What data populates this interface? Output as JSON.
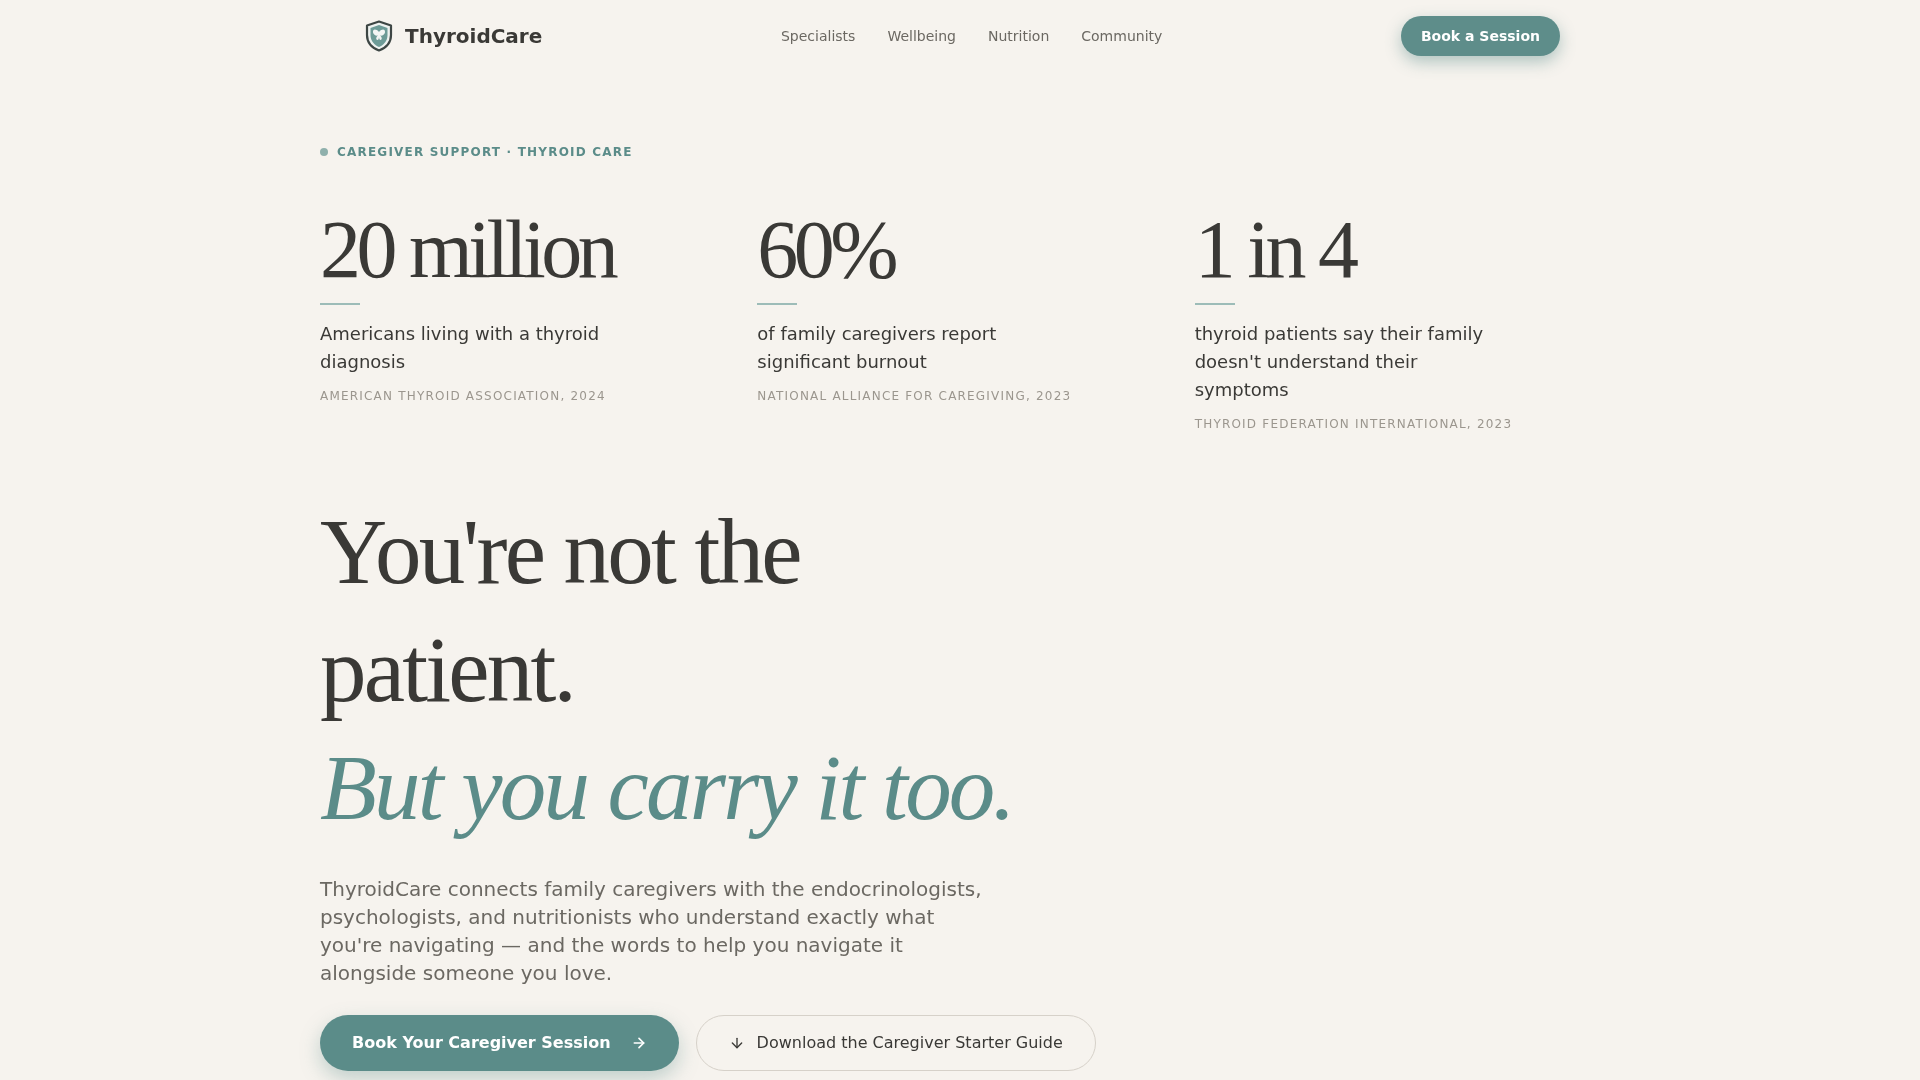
{
  "header": {
    "brand": "ThyroidCare",
    "nav": [
      {
        "label": "Specialists"
      },
      {
        "label": "Wellbeing"
      },
      {
        "label": "Nutrition"
      },
      {
        "label": "Community"
      }
    ],
    "cta": "Book a Session"
  },
  "hero": {
    "eyebrow": "CAREGIVER SUPPORT · THYROID CARE",
    "stats": [
      {
        "value": "20 million",
        "description": "Americans living with a thyroid diagnosis",
        "source": "AMERICAN THYROID ASSOCIATION, 2024"
      },
      {
        "value": "60%",
        "description": "of family caregivers report significant burnout",
        "source": "NATIONAL ALLIANCE FOR CAREGIVING, 2023"
      },
      {
        "value": "1 in 4",
        "description": "thyroid patients say their family doesn't understand their symptoms",
        "source": "THYROID FEDERATION INTERNATIONAL, 2023"
      }
    ],
    "headline": "You're not the patient.",
    "headline_emphasis": "But you carry it too.",
    "intro": "ThyroidCare connects family caregivers with the endocrinologists, psychologists, and nutritionists who understand exactly what you're navigating — and the words to help you navigate it alongside someone you love.",
    "buttons": [
      {
        "kind": "primary",
        "label": "Book Your Caregiver Session"
      },
      {
        "kind": "secondary",
        "label": "Download the Caregiver Starter Guide"
      }
    ]
  }
}
